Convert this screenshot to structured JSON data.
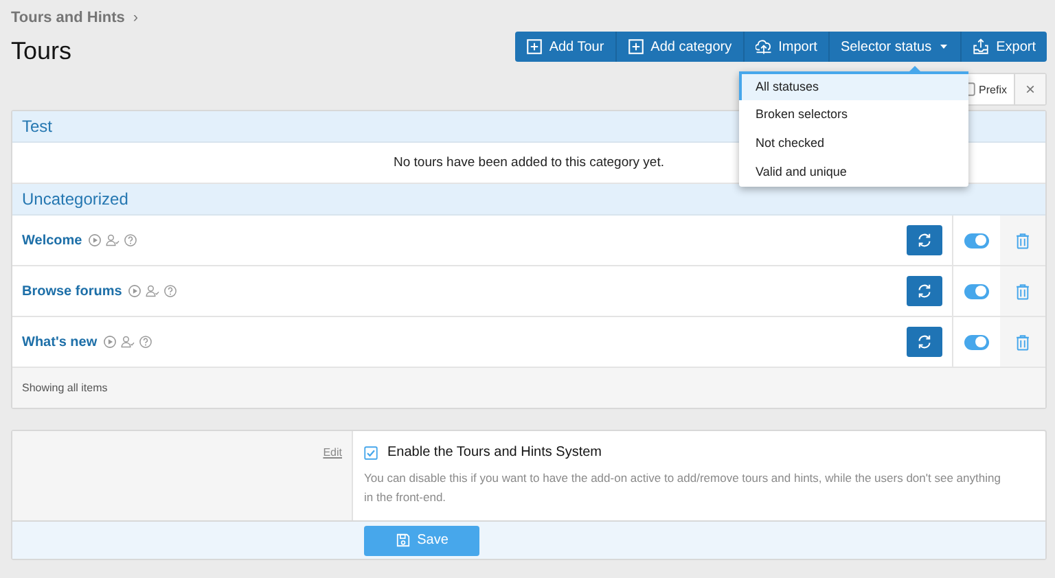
{
  "breadcrumb": {
    "label": "Tours and Hints",
    "separator": "›"
  },
  "title": "Tours",
  "toolbar": [
    {
      "kind": "add",
      "label": "Add Tour"
    },
    {
      "kind": "add",
      "label": "Add category"
    },
    {
      "kind": "import",
      "label": "Import"
    },
    {
      "kind": "dropdown",
      "label": "Selector status"
    },
    {
      "kind": "export",
      "label": "Export"
    }
  ],
  "filter": {
    "prefix_label": "Prefix",
    "prefix_checked": false,
    "clear": "×"
  },
  "status_menu": [
    {
      "label": "All statuses",
      "selected": true
    },
    {
      "label": "Broken selectors",
      "selected": false
    },
    {
      "label": "Not checked",
      "selected": false
    },
    {
      "label": "Valid and unique",
      "selected": false
    }
  ],
  "categories": [
    {
      "name": "Test",
      "empty_text": "No tours have been added to this category yet."
    },
    {
      "name": "Uncategorized",
      "tours": [
        {
          "name": "Welcome",
          "on": true
        },
        {
          "name": "Browse forums",
          "on": true
        },
        {
          "name": "What's new",
          "on": true
        }
      ]
    }
  ],
  "list_footer": "Showing all items",
  "options": {
    "edit_link": "Edit",
    "checked": true,
    "label": "Enable the Tours and Hints System",
    "hint": "You can disable this if you want to have the add-on active to add/remove tours and hints, while the users don't see anything in the front-end.",
    "save": "Save"
  }
}
